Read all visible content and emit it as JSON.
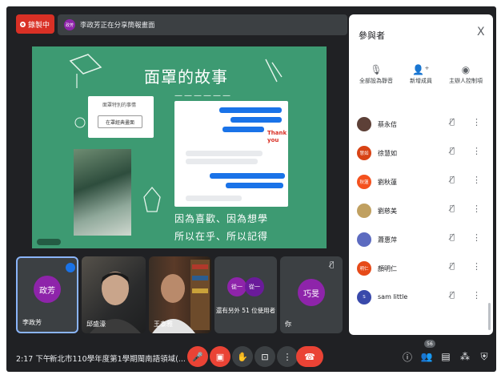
{
  "top": {
    "recording_label": "錄製中",
    "share_avatar": "政芳",
    "share_text": "李政芳正在分享簡報畫面"
  },
  "slide": {
    "title": "面罩的故事",
    "dash": "——————",
    "card_title": "面罩特別的事情",
    "card_button": "在罩經典畫面",
    "thanks": "Thank you",
    "line1": "因為喜歡、因為想學",
    "line2": "所以在乎、所以記得"
  },
  "tiles": [
    {
      "avatar": "政芳",
      "name": "李政芳",
      "color": "#8e24aa"
    },
    {
      "name": "邱盛濠"
    },
    {
      "name": "王泰雅"
    },
    {
      "avatar1": "從一",
      "avatar2": "從一",
      "name": "還有另外 51 位使用者"
    },
    {
      "avatar": "巧旻",
      "name": "你",
      "color": "#8e24aa"
    }
  ],
  "bottom": {
    "time": "2:17 下午",
    "meeting_name": "新北市110學年度第1學期閩南語領域(...",
    "participants_badge": "56"
  },
  "panel": {
    "title": "參與者",
    "close": "X",
    "actions": [
      "全部設為靜音",
      "新增成員",
      "主辦人控制項"
    ],
    "people": [
      {
        "name": "蔡永佶",
        "avatar": "",
        "color": "#5d4037"
      },
      {
        "name": "徐慧如",
        "avatar": "慧如",
        "color": "#d84315"
      },
      {
        "name": "劉秋蓮",
        "avatar": "秋蓮",
        "color": "#f4511e"
      },
      {
        "name": "劉慈美",
        "avatar": "",
        "color": "#c0a060"
      },
      {
        "name": "蕭惠萍",
        "avatar": "",
        "color": "#5c6bc0"
      },
      {
        "name": "顏明仁",
        "avatar": "明仁",
        "color": "#e64a19"
      },
      {
        "name": "sam little",
        "avatar": "S",
        "color": "#3949ab"
      }
    ]
  },
  "colors": {
    "accent_red": "#d93025",
    "bg_dark": "#202124",
    "slide_green": "#3d9a72"
  },
  "icons": [
    "mic-off-icon",
    "camera-off-icon",
    "raise-hand-icon",
    "present-icon",
    "more-icon",
    "end-call-icon",
    "info-icon",
    "people-icon",
    "chat-icon",
    "activities-icon",
    "security-icon"
  ]
}
